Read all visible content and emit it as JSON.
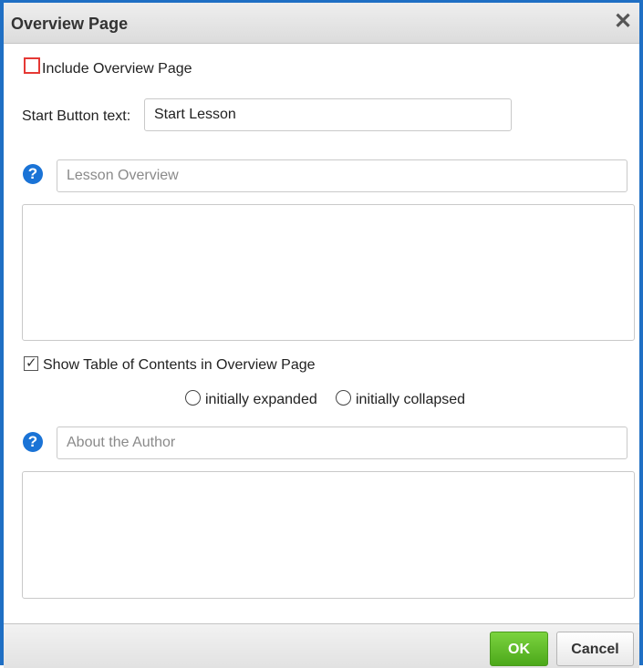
{
  "dialog": {
    "title": "Overview Page",
    "close_glyph": "✕"
  },
  "include_overview": {
    "label": "Include Overview Page",
    "checked": false
  },
  "start_button": {
    "label": "Start Button text:",
    "value": "Start Lesson"
  },
  "lesson_overview": {
    "help_glyph": "?",
    "placeholder": "Lesson Overview",
    "body": ""
  },
  "toc": {
    "label": "Show Table of Contents in Overview Page",
    "checked": true,
    "check_glyph": "✓",
    "options": [
      {
        "label": "initially expanded",
        "selected": false
      },
      {
        "label": "initially collapsed",
        "selected": false
      }
    ]
  },
  "about_author": {
    "help_glyph": "?",
    "placeholder": "About the Author",
    "body": ""
  },
  "footer": {
    "ok_label": "OK",
    "cancel_label": "Cancel"
  },
  "colors": {
    "frame": "#1f6fc4",
    "help_icon": "#1a73d6",
    "ok_button": "#5bbd24",
    "highlight_box": "#e53935"
  }
}
